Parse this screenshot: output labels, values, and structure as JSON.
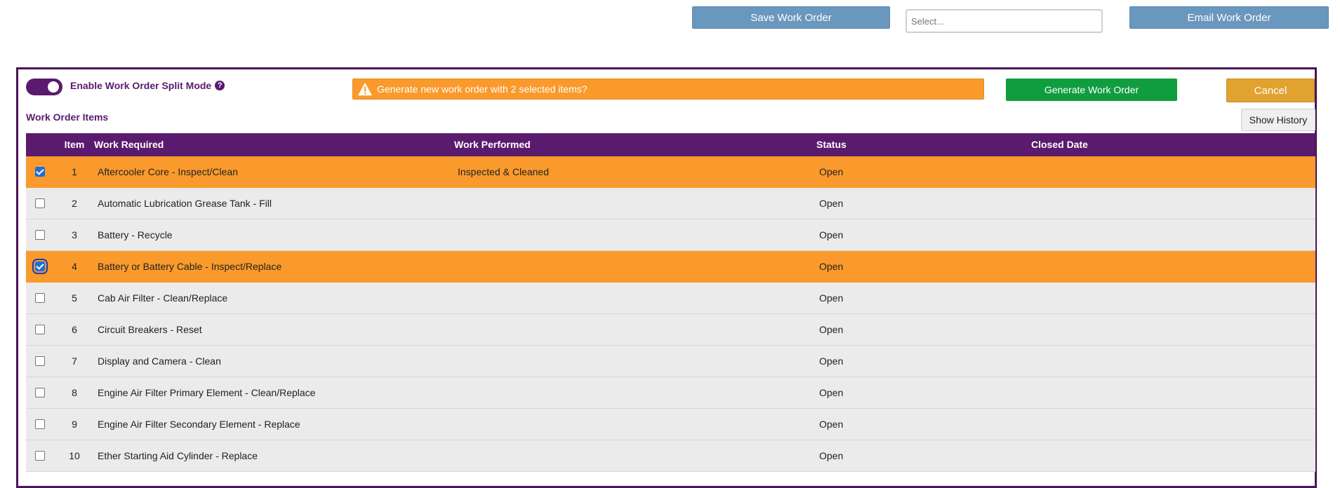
{
  "toolbar": {
    "save_label": "Save Work Order",
    "select_placeholder": "Select...",
    "email_label": "Email Work Order"
  },
  "split": {
    "label": "Enable Work Order Split Mode",
    "help": "?",
    "enabled": true
  },
  "alert": {
    "text": "Generate new work order with 2 selected items?"
  },
  "actions": {
    "generate_label": "Generate Work Order",
    "cancel_label": "Cancel",
    "history_label": "Show History"
  },
  "section": {
    "title": "Work Order Items"
  },
  "table": {
    "headers": {
      "item": "Item",
      "required": "Work Required",
      "performed": "Work Performed",
      "status": "Status",
      "closed": "Closed Date"
    },
    "rows": [
      {
        "item": "1",
        "required": "Aftercooler Core - Inspect/Clean",
        "performed": "Inspected & Cleaned",
        "status": "Open",
        "closed": "",
        "checked": true
      },
      {
        "item": "2",
        "required": "Automatic Lubrication Grease Tank - Fill",
        "performed": "",
        "status": "Open",
        "closed": "",
        "checked": false
      },
      {
        "item": "3",
        "required": "Battery - Recycle",
        "performed": "",
        "status": "Open",
        "closed": "",
        "checked": false
      },
      {
        "item": "4",
        "required": "Battery or Battery Cable - Inspect/Replace",
        "performed": "",
        "status": "Open",
        "closed": "",
        "checked": true
      },
      {
        "item": "5",
        "required": "Cab Air Filter - Clean/Replace",
        "performed": "",
        "status": "Open",
        "closed": "",
        "checked": false
      },
      {
        "item": "6",
        "required": "Circuit Breakers - Reset",
        "performed": "",
        "status": "Open",
        "closed": "",
        "checked": false
      },
      {
        "item": "7",
        "required": "Display and Camera - Clean",
        "performed": "",
        "status": "Open",
        "closed": "",
        "checked": false
      },
      {
        "item": "8",
        "required": "Engine Air Filter Primary Element - Clean/Replace",
        "performed": "",
        "status": "Open",
        "closed": "",
        "checked": false
      },
      {
        "item": "9",
        "required": "Engine Air Filter Secondary Element - Replace",
        "performed": "",
        "status": "Open",
        "closed": "",
        "checked": false
      },
      {
        "item": "10",
        "required": "Ether Starting Aid Cylinder - Replace",
        "performed": "",
        "status": "Open",
        "closed": "",
        "checked": false
      }
    ]
  },
  "colors": {
    "brand_purple": "#5a1a6e",
    "selected_row": "#fa9a2c",
    "generate_green": "#0f9d3f",
    "cancel_gold": "#e1a22f",
    "toolbar_blue": "#6a97bd"
  }
}
